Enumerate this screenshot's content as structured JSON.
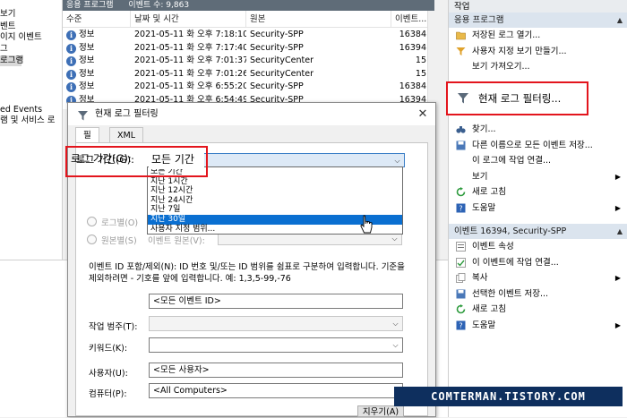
{
  "tree": {
    "items": [
      "보기",
      "벤트",
      "이지 이벤트",
      "그",
      "로그램",
      "ed Events",
      "램 및 서비스 로"
    ],
    "selected_index": 4
  },
  "log_header": {
    "title": "응용 프로그램",
    "count": "이벤트 수: 9,863"
  },
  "table": {
    "columns": [
      "수준",
      "날짜 및 시간",
      "원본",
      "이벤트..."
    ],
    "rows": [
      {
        "level": "정보",
        "datetime": "2021-05-11 화 오후 7:18:10",
        "source": "Security-SPP",
        "id": "16384"
      },
      {
        "level": "정보",
        "datetime": "2021-05-11 화 오후 7:17:40",
        "source": "Security-SPP",
        "id": "16394"
      },
      {
        "level": "정보",
        "datetime": "2021-05-11 화 오후 7:01:37",
        "source": "SecurityCenter",
        "id": "15"
      },
      {
        "level": "정보",
        "datetime": "2021-05-11 화 오후 7:01:26",
        "source": "SecurityCenter",
        "id": "15"
      },
      {
        "level": "정보",
        "datetime": "2021-05-11 화 오후 6:55:20",
        "source": "Security-SPP",
        "id": "16384"
      },
      {
        "level": "정보",
        "datetime": "2021-05-11 화 오후 6:54:49",
        "source": "Security-SPP",
        "id": "16394"
      }
    ],
    "info_glyph": "i"
  },
  "actions": {
    "pane_title": "작업",
    "section1": "응용 프로그램",
    "section1_items": [
      {
        "label": "저장된 로그 열기...",
        "icon": "folder-icon"
      },
      {
        "label": "사용자 지정 보기 만들기...",
        "icon": "filter-icon"
      },
      {
        "label": "보기 가져오기...",
        "icon": ""
      },
      {
        "label": "",
        "icon": ""
      },
      {
        "label": "현재 로그 필터링...",
        "icon": "filter-icon"
      },
      {
        "label": "",
        "icon": ""
      },
      {
        "label": "찾기...",
        "icon": "binoculars-icon"
      },
      {
        "label": "다른 이름으로 모든 이벤트 저장...",
        "icon": "save-icon"
      },
      {
        "label": "이 로그에 작업 연결...",
        "icon": ""
      },
      {
        "label": "보기",
        "icon": "",
        "arrow": "▶"
      },
      {
        "label": "새로 고침",
        "icon": "refresh-icon"
      },
      {
        "label": "도움말",
        "icon": "help-icon",
        "arrow": "▶"
      }
    ],
    "section2": "이벤트 16394, Security-SPP",
    "section2_items": [
      {
        "label": "이벤트 속성",
        "icon": "properties-icon"
      },
      {
        "label": "이 이벤트에 작업 연결...",
        "icon": "task-icon"
      },
      {
        "label": "복사",
        "icon": "copy-icon",
        "arrow": "▶"
      },
      {
        "label": "선택한 이벤트 저장...",
        "icon": "save-icon"
      },
      {
        "label": "새로 고침",
        "icon": "refresh-icon"
      },
      {
        "label": "도움말",
        "icon": "help-icon",
        "arrow": "▶"
      }
    ],
    "collapse_glyph": "▲"
  },
  "callout": {
    "label": "현재 로그 필터링..."
  },
  "dialog": {
    "title": "현재 로그 필터링",
    "close": "✕",
    "tabs": [
      "필터",
      "XML"
    ],
    "log_time_label": "로그 기간(G):",
    "log_time_value": "모든 기간",
    "log_time_options": [
      "모든 기간",
      "지난 1시간",
      "지난 12시간",
      "지난 24시간",
      "지난 7일",
      "지난 30일",
      "사용자 지정 범위..."
    ],
    "highlighted_option": 5,
    "by_log": "로그별(O)",
    "by_source": "원본별(S)",
    "event_source": "이벤트 원본(V):",
    "event_id_help": "이벤트 ID 포함/제외(N): ID 번호 및/또는 ID 범위를 쉼표로 구분하여 입력합니다. 기준을 제외하려면 - 기호를 앞에 입력합니다. 예: 1,3,5-99,-76",
    "event_id_placeholder": "<모든 이벤트 ID>",
    "task_category": "작업 범주(T):",
    "keywords": "키워드(K):",
    "user": "사용자(U):",
    "user_value": "<모든 사용자>",
    "computer": "컴퓨터(P):",
    "computer_value": "<All Computers>",
    "clear_button": "지우기(A)",
    "dd_glyph": "⌵"
  },
  "watermark": "COMTERMAN.TISTORY.COM",
  "colors": {
    "highlight": "#0a6fd1",
    "callout": "#e3151d",
    "section_header": "#dbe4ee"
  }
}
